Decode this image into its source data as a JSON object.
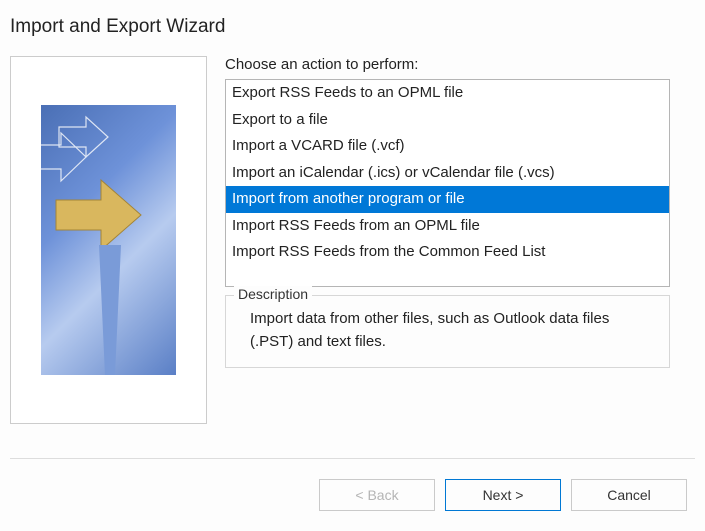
{
  "title": "Import and Export Wizard",
  "prompt": "Choose an action to perform:",
  "actions": [
    {
      "label": "Export RSS Feeds to an OPML file",
      "selected": false
    },
    {
      "label": "Export to a file",
      "selected": false
    },
    {
      "label": "Import a VCARD file (.vcf)",
      "selected": false
    },
    {
      "label": "Import an iCalendar (.ics) or vCalendar file (.vcs)",
      "selected": false
    },
    {
      "label": "Import from another program or file",
      "selected": true
    },
    {
      "label": "Import RSS Feeds from an OPML file",
      "selected": false
    },
    {
      "label": "Import RSS Feeds from the Common Feed List",
      "selected": false
    }
  ],
  "description": {
    "legend": "Description",
    "text": "Import data from other files, such as Outlook data files (.PST) and text files."
  },
  "buttons": {
    "back": "< Back",
    "next": "Next >",
    "cancel": "Cancel"
  },
  "buttons_state": {
    "back_enabled": false
  }
}
